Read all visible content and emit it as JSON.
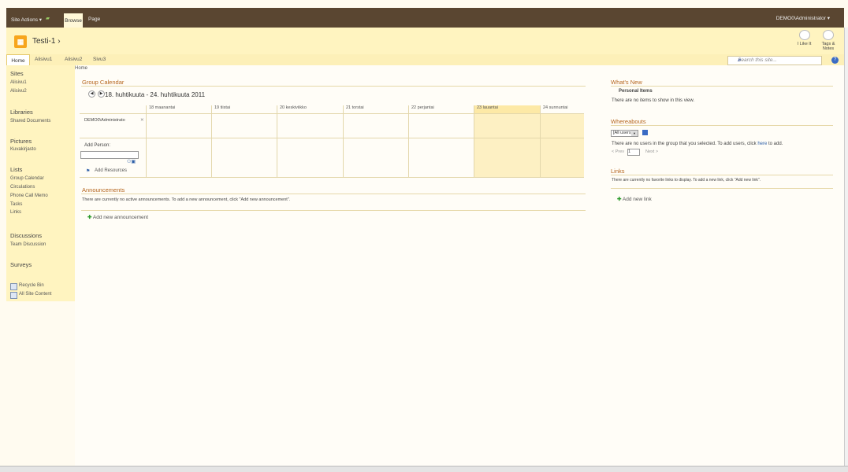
{
  "ribbon": {
    "site_actions": "Site Actions ▾",
    "browse_tab": "Browse",
    "page_tab": "Page",
    "user": "DEMO0\\Administrator ▾"
  },
  "title_area": {
    "site_title": "Testi-1 ›",
    "i_like_it": "I Like It",
    "tags_notes": "Tags & Notes"
  },
  "topnav": {
    "items": [
      "Home",
      "Alisivu1",
      "Alisivu2",
      "Sivu3"
    ],
    "search_placeholder": "Search this site...",
    "help": "?"
  },
  "sidebar": {
    "sites_heading": "Sites",
    "sites": [
      "Alisivu1",
      "Alisivu2"
    ],
    "libraries_heading": "Libraries",
    "libraries": [
      "Shared Documents"
    ],
    "pictures_heading": "Pictures",
    "pictures": [
      "Kuvakirjasto"
    ],
    "lists_heading": "Lists",
    "lists": [
      "Group Calendar",
      "Circulations",
      "Phone Call Memo",
      "Tasks",
      "Links"
    ],
    "discussions_heading": "Discussions",
    "discussions": [
      "Team Discussion"
    ],
    "surveys_heading": "Surveys",
    "recycle_bin": "Recycle Bin",
    "all_site_content": "All Site Content"
  },
  "main": {
    "breadcrumb": "Home",
    "calendar": {
      "title": "Group Calendar",
      "range": "18. huhtikuuta - 24. huhtikuuta 2011",
      "days": [
        "18 maanantai",
        "19 tiistai",
        "20 keskiviikko",
        "21 torstai",
        "22 perjantai",
        "23 lauantai",
        "24 sunnuntai"
      ],
      "person": "DEMO0\\Administrato",
      "remove": "✕",
      "add_person": "Add Person:",
      "add_resources": "Add Resources"
    },
    "announcements": {
      "title": "Announcements",
      "empty": "There are currently no active announcements. To add a new announcement, click \"Add new announcement\".",
      "add": "Add new announcement"
    }
  },
  "right": {
    "whats_new": {
      "title": "What's New",
      "personal_items": "Personal Items",
      "empty": "There are no items to show in this view."
    },
    "whereabouts": {
      "title": "Whereabouts",
      "filter": "[All users]",
      "empty_pre": "There are no users in the group that you selected. To add users, click ",
      "empty_link": "here",
      "empty_post": " to add.",
      "prev": "< Prev",
      "page": "1",
      "next": "Next >"
    },
    "links": {
      "title": "Links",
      "empty": "There are currently no favorite links to display. To add a new link, click \"Add new link\".",
      "add": "Add new link"
    }
  }
}
